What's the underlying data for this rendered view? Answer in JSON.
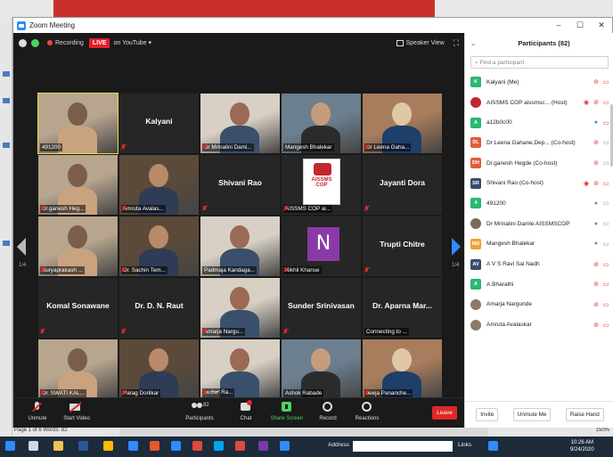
{
  "window": {
    "title": "Zoom Meeting",
    "controls": {
      "minimize": "–",
      "maximize": "☐",
      "close": "✕"
    }
  },
  "topbar": {
    "recording": "Recording",
    "live": "LIVE",
    "live_target": "on YouTube ▾",
    "view": "Speaker View",
    "fullscreen": "⛶"
  },
  "pagination": {
    "left": "1/4",
    "right": "1/4"
  },
  "tiles": [
    {
      "label": "491200",
      "kind": "video",
      "active": true
    },
    {
      "label": "Kalyani",
      "kind": "name",
      "muted": true
    },
    {
      "label": "Dr Mrinalini Dami...",
      "kind": "video",
      "muted": true
    },
    {
      "label": "Mangesh Bhalekar",
      "kind": "video"
    },
    {
      "label": "Dr Leena Gaha...",
      "kind": "video",
      "muted": true
    },
    {
      "label": "Dr.ganesh Heg...",
      "kind": "video",
      "muted": true
    },
    {
      "label": "Amruta Avalas...",
      "kind": "video",
      "muted": true
    },
    {
      "label": "Shivani Rao",
      "kind": "name",
      "muted": true
    },
    {
      "label": "AISSMS COP ai...",
      "kind": "logo",
      "muted": true,
      "logo_text": "AISSMS\nCOP"
    },
    {
      "label": "Jayanti Dora",
      "kind": "name",
      "muted": true
    },
    {
      "label": "Suryaprakash ...",
      "kind": "video",
      "muted": true
    },
    {
      "label": "Dr. Sachin Tem...",
      "kind": "video",
      "muted": true
    },
    {
      "label": "Padmaja Kandaga...",
      "kind": "video"
    },
    {
      "label": "Nikhil Khanse",
      "kind": "letter",
      "muted": true,
      "letter": "N"
    },
    {
      "label": "Trupti Chitre",
      "kind": "name",
      "muted": true
    },
    {
      "label": "Komal Sonawane",
      "kind": "name",
      "muted": true
    },
    {
      "label": "Dr. D. N. Raut",
      "kind": "name",
      "muted": true
    },
    {
      "label": "Amarja Nargu...",
      "kind": "video",
      "muted": true
    },
    {
      "label": "Sunder Srinivasan",
      "kind": "name",
      "muted": true
    },
    {
      "label": "Dr. Aparna Mar...",
      "kind": "name",
      "sub": "Connecting to ..."
    },
    {
      "label": "Dr. SWATI KAL...",
      "kind": "video",
      "muted": true
    },
    {
      "label": "Parag Dorlikar",
      "kind": "video",
      "muted": true
    },
    {
      "label": "ರಾಜೇಶ್ Ra...",
      "kind": "video",
      "muted": true
    },
    {
      "label": "Ashok Rabade",
      "kind": "video"
    },
    {
      "label": "Jeeja Pananche...",
      "kind": "video",
      "muted": true
    }
  ],
  "toolbar": {
    "unmute": "Unmute",
    "start_video": "Start Video",
    "participants": "Participants",
    "participants_count": "82",
    "chat": "Chat",
    "share_screen": "Share Screen",
    "record": "Record",
    "reactions": "Reactions",
    "leave": "Leave"
  },
  "panel": {
    "title": "Participants (82)",
    "search_placeholder": "Find a participant",
    "participants": [
      {
        "name": "Kalyani (Me)",
        "avatar": "K",
        "color": "#2bb673",
        "mic": "muted",
        "video": "off"
      },
      {
        "name": "AISSMS COP aissmsc... (Host)",
        "avatar": "",
        "color": "#c0282d",
        "mic": "muted",
        "video": "off",
        "rec": true
      },
      {
        "name": "a12b0c00",
        "avatar": "A",
        "color": "#2bb673",
        "mic": "on",
        "video": "off"
      },
      {
        "name": "Dr Leena Gahane,Dep... (Co-host)",
        "avatar": "DL",
        "color": "#e55a3c",
        "mic": "muted",
        "video": "on"
      },
      {
        "name": "Dr.ganesh Hegde (Co-host)",
        "avatar": "DH",
        "color": "#e55a3c",
        "mic": "muted",
        "video": "on"
      },
      {
        "name": "Shivani Rao (Co-host)",
        "avatar": "SR",
        "color": "#3b4a6b",
        "mic": "muted",
        "video": "off",
        "rec": true
      },
      {
        "name": "491200",
        "avatar": "4",
        "color": "#2bb673",
        "mic": "unmuted",
        "video": "on"
      },
      {
        "name": "Dr Mrinalini Damle AISSMSCOP",
        "avatar": "",
        "color": "#7a6a5a",
        "mic": "unmuted",
        "video": "on"
      },
      {
        "name": "Mangesh Bhalekar",
        "avatar": "MB",
        "color": "#f0a030",
        "mic": "unmuted",
        "video": "on"
      },
      {
        "name": "A V S Ravi Sai Nadh",
        "avatar": "AV",
        "color": "#3b4a6b",
        "mic": "muted",
        "video": "off"
      },
      {
        "name": "A.Bharathi",
        "avatar": "A",
        "color": "#2bb673",
        "mic": "muted",
        "video": "off"
      },
      {
        "name": "Amarja Nargunde",
        "avatar": "",
        "color": "#8a7a6a",
        "mic": "muted",
        "video": "off"
      },
      {
        "name": "Amruta Avalaskar",
        "avatar": "",
        "color": "#8a7a6a",
        "mic": "muted",
        "video": "off"
      }
    ],
    "invite": "Invite",
    "unmute_me": "Unmute Me",
    "raise_hand": "Raise Hand"
  },
  "statusbar": {
    "left": "Page 1 of 6   Words: 82",
    "right": "150%"
  },
  "taskbar": {
    "address": "Address",
    "links": "Links",
    "time": "10:26 AM",
    "date": "9/24/2020"
  }
}
